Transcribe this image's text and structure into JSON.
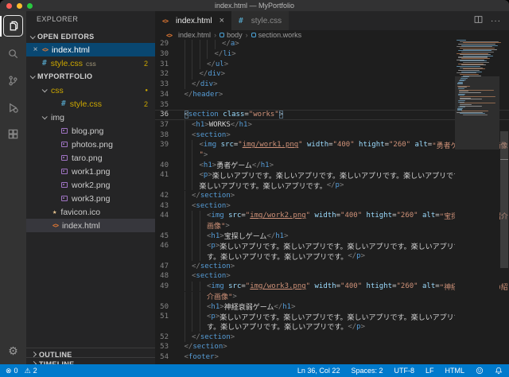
{
  "title_bar": {
    "title": "index.html — MyPortfolio"
  },
  "colors": {
    "status_bar": "#007acc",
    "warning": "#cca700",
    "html_icon": "#e37933",
    "css_icon": "#519aba",
    "image_icon": "#a074c4",
    "selection": "#094771"
  },
  "activity_bar": {
    "items": [
      {
        "icon": "explorer-icon",
        "active": true
      },
      {
        "icon": "search-icon"
      },
      {
        "icon": "source-control-icon"
      },
      {
        "icon": "debug-icon"
      },
      {
        "icon": "extensions-icon"
      }
    ],
    "bottom_icon": "gear-icon",
    "gear_glyph": "⚙"
  },
  "sidebar": {
    "explorer_title": "EXPLORER",
    "open_editors": {
      "header": "OPEN EDITORS",
      "items": [
        {
          "label": "index.html",
          "icon": "html",
          "selected": true,
          "close": "×"
        },
        {
          "label": "style.css",
          "icon": "css",
          "hint": "css",
          "badge": "2",
          "warn": true
        }
      ]
    },
    "tree": {
      "header": "MYPORTFOLIO",
      "items": [
        {
          "label": "css",
          "folder": true,
          "expanded": true,
          "depth": 0,
          "badge": "●",
          "warn": true
        },
        {
          "label": "style.css",
          "icon": "css",
          "depth": 1,
          "badge": "2",
          "warn": true
        },
        {
          "label": "img",
          "folder": true,
          "expanded": true,
          "depth": 0
        },
        {
          "label": "blog.png",
          "icon": "image",
          "depth": 1
        },
        {
          "label": "photos.png",
          "icon": "image",
          "depth": 1
        },
        {
          "label": "taro.png",
          "icon": "image",
          "depth": 1
        },
        {
          "label": "work1.png",
          "icon": "image",
          "depth": 1
        },
        {
          "label": "work2.png",
          "icon": "image",
          "depth": 1
        },
        {
          "label": "work3.png",
          "icon": "image",
          "depth": 1
        },
        {
          "label": "favicon.ico",
          "icon": "star",
          "star_glyph": "★",
          "depth": 0
        },
        {
          "label": "index.html",
          "icon": "html",
          "depth": 0,
          "active": true
        }
      ]
    },
    "outline_header": "OUTLINE",
    "timeline_header": "TIMELINE"
  },
  "tabs": {
    "items": [
      {
        "label": "index.html",
        "icon": "html",
        "active": true,
        "close": "×"
      },
      {
        "label": "style.css",
        "icon": "css",
        "active": false
      }
    ],
    "actions": [
      {
        "icon": "split-editor-icon"
      },
      {
        "icon": "more-actions-icon",
        "glyph": "···"
      }
    ]
  },
  "breadcrumbs": [
    {
      "label": "index.html",
      "icon": "html"
    },
    {
      "label": "body",
      "icon": "symbol"
    },
    {
      "label": "section.works",
      "icon": "symbol"
    }
  ],
  "editor": {
    "file_icons": {
      "html_glyph": "<>",
      "css_glyph": "#"
    },
    "rows": [
      {
        "n": "29",
        "segs": [
          [
            "sp",
            "            "
          ],
          [
            "p",
            "</"
          ],
          [
            "t",
            "a"
          ],
          [
            "p",
            ">"
          ]
        ]
      },
      {
        "n": "30",
        "segs": [
          [
            "sp",
            "          "
          ],
          [
            "p",
            "</"
          ],
          [
            "t",
            "li"
          ],
          [
            "p",
            ">"
          ]
        ]
      },
      {
        "n": "31",
        "segs": [
          [
            "sp",
            "        "
          ],
          [
            "p",
            "</"
          ],
          [
            "t",
            "ul"
          ],
          [
            "p",
            ">"
          ]
        ]
      },
      {
        "n": "32",
        "segs": [
          [
            "sp",
            "      "
          ],
          [
            "p",
            "</"
          ],
          [
            "t",
            "div"
          ],
          [
            "p",
            ">"
          ]
        ]
      },
      {
        "n": "33",
        "segs": [
          [
            "sp",
            "    "
          ],
          [
            "p",
            "</"
          ],
          [
            "t",
            "div"
          ],
          [
            "p",
            ">"
          ]
        ]
      },
      {
        "n": "34",
        "segs": [
          [
            "sp",
            "  "
          ],
          [
            "p",
            "</"
          ],
          [
            "t",
            "header"
          ],
          [
            "p",
            ">"
          ]
        ]
      },
      {
        "n": "35",
        "segs": []
      },
      {
        "n": "36",
        "cur": true,
        "segs": [
          [
            "sp",
            "  "
          ],
          [
            "pb",
            "<"
          ],
          [
            "t",
            "section"
          ],
          [
            "o",
            " "
          ],
          [
            "a",
            "class"
          ],
          [
            "o",
            "="
          ],
          [
            "s",
            "\"works\""
          ],
          [
            "pb",
            ">"
          ]
        ]
      },
      {
        "n": "37",
        "segs": [
          [
            "sp",
            "    "
          ],
          [
            "p",
            "<"
          ],
          [
            "t",
            "h1"
          ],
          [
            "p",
            ">"
          ],
          [
            "x",
            "WORKS"
          ],
          [
            "p",
            "</"
          ],
          [
            "t",
            "h1"
          ],
          [
            "p",
            ">"
          ]
        ]
      },
      {
        "n": "38",
        "segs": [
          [
            "sp",
            "    "
          ],
          [
            "p",
            "<"
          ],
          [
            "t",
            "section"
          ],
          [
            "p",
            ">"
          ]
        ]
      },
      {
        "n": "39",
        "segs": [
          [
            "sp",
            "      "
          ],
          [
            "p",
            "<"
          ],
          [
            "t",
            "img"
          ],
          [
            "o",
            " "
          ],
          [
            "a",
            "src"
          ],
          [
            "o",
            "="
          ],
          [
            "s",
            "\""
          ],
          [
            "l",
            "img/work1.png"
          ],
          [
            "s",
            "\""
          ],
          [
            "o",
            " "
          ],
          [
            "a",
            "width"
          ],
          [
            "o",
            "="
          ],
          [
            "s",
            "\"400\""
          ],
          [
            "o",
            " "
          ],
          [
            "a",
            "htight"
          ],
          [
            "o",
            "="
          ],
          [
            "s",
            "\"260\""
          ],
          [
            "o",
            " "
          ],
          [
            "a",
            "alt"
          ],
          [
            "o",
            "="
          ],
          [
            "s",
            "\"勇者ゲームの紹介画像"
          ]
        ]
      },
      {
        "n": "",
        "segs": [
          [
            "sp",
            "      "
          ],
          [
            "s",
            "\""
          ],
          [
            "p",
            ">"
          ]
        ]
      },
      {
        "n": "40",
        "segs": [
          [
            "sp",
            "      "
          ],
          [
            "p",
            "<"
          ],
          [
            "t",
            "h1"
          ],
          [
            "p",
            ">"
          ],
          [
            "x",
            "勇者ゲーム"
          ],
          [
            "p",
            "</"
          ],
          [
            "t",
            "h1"
          ],
          [
            "p",
            ">"
          ]
        ]
      },
      {
        "n": "41",
        "segs": [
          [
            "sp",
            "      "
          ],
          [
            "p",
            "<"
          ],
          [
            "t",
            "p"
          ],
          [
            "p",
            ">"
          ],
          [
            "x",
            "楽しいアプリです。楽しいアプリです。楽しいアプリです。楽しいアプリです。"
          ]
        ]
      },
      {
        "n": "",
        "segs": [
          [
            "sp",
            "      "
          ],
          [
            "x",
            "楽しいアプリです。楽しいアプリです。"
          ],
          [
            "p",
            "</"
          ],
          [
            "t",
            "p"
          ],
          [
            "p",
            ">"
          ]
        ]
      },
      {
        "n": "42",
        "segs": [
          [
            "sp",
            "    "
          ],
          [
            "p",
            "</"
          ],
          [
            "t",
            "section"
          ],
          [
            "p",
            ">"
          ]
        ]
      },
      {
        "n": "43",
        "segs": [
          [
            "sp",
            "    "
          ],
          [
            "p",
            "<"
          ],
          [
            "t",
            "section"
          ],
          [
            "p",
            ">"
          ]
        ]
      },
      {
        "n": "44",
        "segs": [
          [
            "sp",
            "        "
          ],
          [
            "p",
            "<"
          ],
          [
            "t",
            "img"
          ],
          [
            "o",
            " "
          ],
          [
            "a",
            "src"
          ],
          [
            "o",
            "="
          ],
          [
            "s",
            "\""
          ],
          [
            "l",
            "img/work2.png"
          ],
          [
            "s",
            "\""
          ],
          [
            "o",
            " "
          ],
          [
            "a",
            "width"
          ],
          [
            "o",
            "="
          ],
          [
            "s",
            "\"400\""
          ],
          [
            "o",
            " "
          ],
          [
            "a",
            "htight"
          ],
          [
            "o",
            "="
          ],
          [
            "s",
            "\"260\""
          ],
          [
            "o",
            " "
          ],
          [
            "a",
            "alt"
          ],
          [
            "o",
            "="
          ],
          [
            "s",
            "\"宝探しゲームの紹介"
          ]
        ]
      },
      {
        "n": "",
        "segs": [
          [
            "sp",
            "        "
          ],
          [
            "s",
            "画像\""
          ],
          [
            "p",
            ">"
          ]
        ]
      },
      {
        "n": "45",
        "segs": [
          [
            "sp",
            "        "
          ],
          [
            "p",
            "<"
          ],
          [
            "t",
            "h1"
          ],
          [
            "p",
            ">"
          ],
          [
            "x",
            "宝探しゲーム"
          ],
          [
            "p",
            "</"
          ],
          [
            "t",
            "h1"
          ],
          [
            "p",
            ">"
          ]
        ]
      },
      {
        "n": "46",
        "segs": [
          [
            "sp",
            "        "
          ],
          [
            "p",
            "<"
          ],
          [
            "t",
            "p"
          ],
          [
            "p",
            ">"
          ],
          [
            "x",
            "楽しいアプリです。楽しいアプリです。楽しいアプリです。楽しいアプリで"
          ]
        ]
      },
      {
        "n": "",
        "segs": [
          [
            "sp",
            "        "
          ],
          [
            "x",
            "す。楽しいアプリです。楽しいアプリです。"
          ],
          [
            "p",
            "</"
          ],
          [
            "t",
            "p"
          ],
          [
            "p",
            ">"
          ]
        ]
      },
      {
        "n": "47",
        "segs": [
          [
            "sp",
            "    "
          ],
          [
            "p",
            "</"
          ],
          [
            "t",
            "section"
          ],
          [
            "p",
            ">"
          ]
        ]
      },
      {
        "n": "48",
        "segs": [
          [
            "sp",
            "    "
          ],
          [
            "p",
            "<"
          ],
          [
            "t",
            "section"
          ],
          [
            "p",
            ">"
          ]
        ]
      },
      {
        "n": "49",
        "segs": [
          [
            "sp",
            "        "
          ],
          [
            "p",
            "<"
          ],
          [
            "t",
            "img"
          ],
          [
            "o",
            " "
          ],
          [
            "a",
            "src"
          ],
          [
            "o",
            "="
          ],
          [
            "s",
            "\""
          ],
          [
            "l",
            "img/work3.png"
          ],
          [
            "s",
            "\""
          ],
          [
            "o",
            " "
          ],
          [
            "a",
            "width"
          ],
          [
            "o",
            "="
          ],
          [
            "s",
            "\"400\""
          ],
          [
            "o",
            " "
          ],
          [
            "a",
            "htight"
          ],
          [
            "o",
            "="
          ],
          [
            "s",
            "\"260\""
          ],
          [
            "o",
            " "
          ],
          [
            "a",
            "alt"
          ],
          [
            "o",
            "="
          ],
          [
            "s",
            "\"神経衰弱ゲームの紹"
          ]
        ]
      },
      {
        "n": "",
        "segs": [
          [
            "sp",
            "        "
          ],
          [
            "s",
            "介画像\""
          ],
          [
            "p",
            ">"
          ]
        ]
      },
      {
        "n": "50",
        "segs": [
          [
            "sp",
            "        "
          ],
          [
            "p",
            "<"
          ],
          [
            "t",
            "h1"
          ],
          [
            "p",
            ">"
          ],
          [
            "x",
            "神経衰弱ゲーム"
          ],
          [
            "p",
            "</"
          ],
          [
            "t",
            "h1"
          ],
          [
            "p",
            ">"
          ]
        ]
      },
      {
        "n": "51",
        "segs": [
          [
            "sp",
            "        "
          ],
          [
            "p",
            "<"
          ],
          [
            "t",
            "p"
          ],
          [
            "p",
            ">"
          ],
          [
            "x",
            "楽しいアプリです。楽しいアプリです。楽しいアプリです。楽しいアプリで"
          ]
        ]
      },
      {
        "n": "",
        "segs": [
          [
            "sp",
            "        "
          ],
          [
            "x",
            "す。楽しいアプリです。楽しいアプリです。"
          ],
          [
            "p",
            "</"
          ],
          [
            "t",
            "p"
          ],
          [
            "p",
            ">"
          ]
        ]
      },
      {
        "n": "52",
        "segs": [
          [
            "sp",
            "    "
          ],
          [
            "p",
            "</"
          ],
          [
            "t",
            "section"
          ],
          [
            "p",
            ">"
          ]
        ]
      },
      {
        "n": "53",
        "segs": [
          [
            "sp",
            "  "
          ],
          [
            "p",
            "</"
          ],
          [
            "t",
            "section"
          ],
          [
            "p",
            ">"
          ]
        ]
      },
      {
        "n": "54",
        "segs": [
          [
            "sp",
            "  "
          ],
          [
            "p",
            "<"
          ],
          [
            "t",
            "footer"
          ],
          [
            "p",
            ">"
          ]
        ]
      }
    ]
  },
  "status_bar": {
    "left": [
      {
        "icon": "error-icon",
        "glyph": "⊗",
        "value": "0"
      },
      {
        "icon": "warning-icon",
        "glyph": "⚠",
        "value": "2"
      }
    ],
    "right": [
      {
        "label": "Ln 36, Col 22"
      },
      {
        "label": "Spaces: 2"
      },
      {
        "label": "UTF-8"
      },
      {
        "label": "LF"
      },
      {
        "label": "HTML"
      },
      {
        "icon": "feedback-icon"
      },
      {
        "icon": "bell-icon"
      }
    ]
  }
}
